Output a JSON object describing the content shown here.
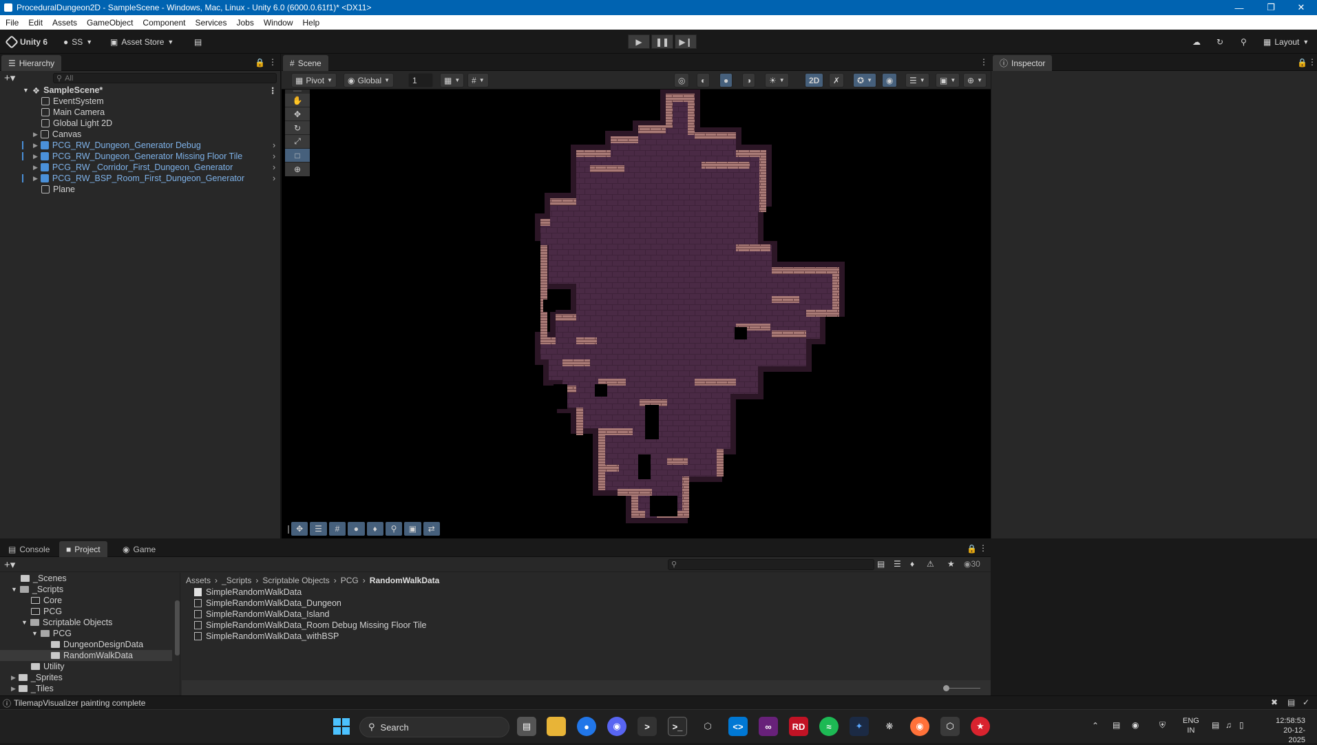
{
  "window": {
    "title": "ProceduralDungeon2D - SampleScene - Windows, Mac, Linux - Unity 6.0 (6000.0.61f1)* <DX11>"
  },
  "menu": [
    "File",
    "Edit",
    "Assets",
    "GameObject",
    "Component",
    "Services",
    "Jobs",
    "Window",
    "Help"
  ],
  "toolbar": {
    "unity_label": "Unity 6",
    "account_label": "SS",
    "asset_store_label": "Asset Store",
    "layout_label": "Layout"
  },
  "hierarchy": {
    "tab_label": "Hierarchy",
    "search_placeholder": "All",
    "scene_name": "SampleScene*",
    "items": [
      {
        "label": "EventSystem"
      },
      {
        "label": "Main Camera"
      },
      {
        "label": "Global Light 2D"
      },
      {
        "label": "Canvas"
      },
      {
        "label": "PCG_RW_Dungeon_Generator Debug"
      },
      {
        "label": "PCG_RW_Dungeon_Generator Missing Floor Tile"
      },
      {
        "label": "PCG_RW _Corridor_First_Dungeon_Generator"
      },
      {
        "label": "PCG_RW_BSP_Room_First_Dungeon_Generator"
      },
      {
        "label": "Plane"
      }
    ]
  },
  "scene": {
    "tab_label": "Scene",
    "pivot_label": "Pivot",
    "global_label": "Global",
    "grid_value": "1",
    "mode_2d_label": "2D"
  },
  "inspector": {
    "tab_label": "Inspector"
  },
  "bottom": {
    "tabs": [
      {
        "label": "Console"
      },
      {
        "label": "Project"
      },
      {
        "label": "Game"
      }
    ],
    "count_label": "30",
    "tree": [
      {
        "label": "_Scenes"
      },
      {
        "label": "_Scripts"
      },
      {
        "label": "Core"
      },
      {
        "label": "PCG"
      },
      {
        "label": "Scriptable Objects"
      },
      {
        "label": "PCG"
      },
      {
        "label": "DungeonDesignData"
      },
      {
        "label": "RandomWalkData"
      },
      {
        "label": "Utility"
      },
      {
        "label": "_Sprites"
      },
      {
        "label": "_Tiles"
      }
    ],
    "breadcrumb": [
      "Assets",
      "_Scripts",
      "Scriptable Objects",
      "PCG",
      "RandomWalkData"
    ],
    "files": [
      {
        "label": "SimpleRandomWalkData"
      },
      {
        "label": "SimpleRandomWalkData_Dungeon"
      },
      {
        "label": "SimpleRandomWalkData_Island"
      },
      {
        "label": "SimpleRandomWalkData_Room Debug Missing Floor Tile"
      },
      {
        "label": "SimpleRandomWalkData_withBSP"
      }
    ]
  },
  "status": {
    "message": "TilemapVisualizer painting complete"
  },
  "taskbar": {
    "search_label": "Search",
    "lang_line1": "ENG",
    "lang_line2": "IN",
    "time": "12:58:53",
    "date": "20-12-2025"
  }
}
